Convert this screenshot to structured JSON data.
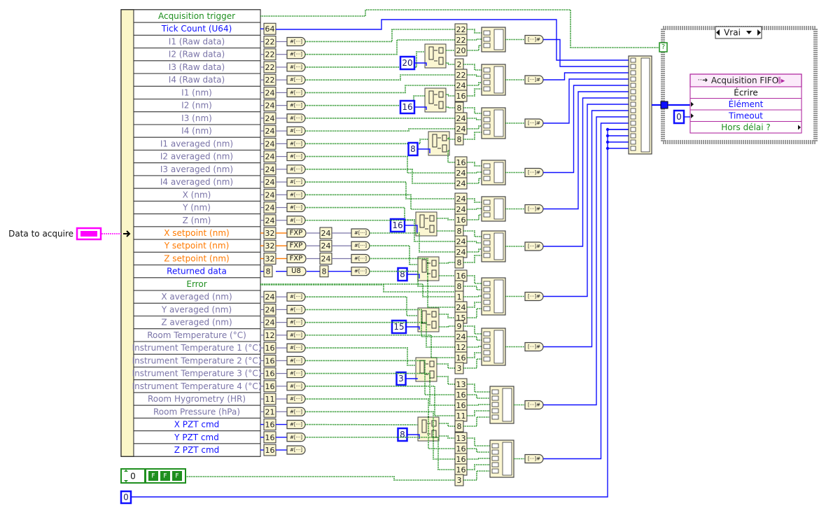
{
  "left_label": "Data to acquire",
  "unbundle": {
    "rows": [
      {
        "label": "Acquisition trigger",
        "type": "bool"
      },
      {
        "label": "Tick Count (U64)",
        "type": "int",
        "width": "64"
      },
      {
        "label": "I1 (Raw data)",
        "type": "fxp",
        "width": "22"
      },
      {
        "label": "I2 (Raw data)",
        "type": "fxp",
        "width": "22"
      },
      {
        "label": "I3 (Raw data)",
        "type": "fxp",
        "width": "22"
      },
      {
        "label": "I4 (Raw data)",
        "type": "fxp",
        "width": "22"
      },
      {
        "label": "I1 (nm)",
        "type": "fxp",
        "width": "24"
      },
      {
        "label": "I2 (nm)",
        "type": "fxp",
        "width": "24"
      },
      {
        "label": "I3 (nm)",
        "type": "fxp",
        "width": "24"
      },
      {
        "label": "I4 (nm)",
        "type": "fxp",
        "width": "24"
      },
      {
        "label": "I1 averaged (nm)",
        "type": "fxp",
        "width": "24"
      },
      {
        "label": "I2 averaged (nm)",
        "type": "fxp",
        "width": "24"
      },
      {
        "label": "I3 averaged (nm)",
        "type": "fxp",
        "width": "24"
      },
      {
        "label": "I4 averaged (nm)",
        "type": "fxp",
        "width": "24"
      },
      {
        "label": "X (nm)",
        "type": "fxp",
        "width": "24"
      },
      {
        "label": "Y (nm)",
        "type": "fxp",
        "width": "24"
      },
      {
        "label": "Z (nm)",
        "type": "fxp",
        "width": "24"
      },
      {
        "label": "X setpoint (nm)",
        "type": "dbl",
        "width": "32",
        "conv": "FXP",
        "conv_width": "24"
      },
      {
        "label": "Y setpoint (nm)",
        "type": "dbl",
        "width": "32",
        "conv": "FXP",
        "conv_width": "24"
      },
      {
        "label": "Z setpoint (nm)",
        "type": "dbl",
        "width": "32",
        "conv": "FXP",
        "conv_width": "24"
      },
      {
        "label": "Returned data",
        "type": "int",
        "width": "8",
        "conv": "U8",
        "conv_width": "8"
      },
      {
        "label": "Error",
        "type": "bool"
      },
      {
        "label": "X averaged (nm)",
        "type": "fxp",
        "width": "24"
      },
      {
        "label": "Y averaged (nm)",
        "type": "fxp",
        "width": "24"
      },
      {
        "label": "Z averaged  (nm)",
        "type": "fxp",
        "width": "24"
      },
      {
        "label": "Room Temperature (°C)",
        "type": "fxp",
        "width": "12"
      },
      {
        "label": "Instrument Temperature 1 (°C)",
        "type": "fxp",
        "width": "16"
      },
      {
        "label": "Instrument Temperature 2 (°C)",
        "type": "fxp",
        "width": "16"
      },
      {
        "label": "Instrument Temperature 3 (°C)",
        "type": "fxp",
        "width": "16"
      },
      {
        "label": "Instrument Temperature 4 (°C)",
        "type": "fxp",
        "width": "16"
      },
      {
        "label": "Room Hygrometry (HR)",
        "type": "fxp",
        "width": "11"
      },
      {
        "label": "Room Pressure (hPa)",
        "type": "fxp",
        "width": "21"
      },
      {
        "label": "X PZT cmd",
        "type": "int",
        "width": "16"
      },
      {
        "label": "Y PZT cmd",
        "type": "int",
        "width": "16"
      },
      {
        "label": "Z PZT cmd",
        "type": "int",
        "width": "16"
      }
    ]
  },
  "split_constants": [
    "20",
    "16",
    "8",
    "16",
    "8",
    "15",
    "3",
    "8"
  ],
  "groups": [
    [
      "22",
      "22",
      "20"
    ],
    [
      "2",
      "22",
      "24",
      "16"
    ],
    [
      "8",
      "24",
      "24",
      "8"
    ],
    [
      "16",
      "24",
      "24"
    ],
    [
      "24",
      "24",
      "16"
    ],
    [
      "8",
      "24",
      "24",
      "8"
    ],
    [
      "16",
      "8",
      "1",
      "24",
      "15"
    ],
    [
      "9",
      "24",
      "12",
      "16",
      "3"
    ],
    [
      "13",
      "16",
      "16",
      "11",
      "8"
    ],
    [
      "13",
      "16",
      "16",
      "16",
      "3"
    ]
  ],
  "case": {
    "selector": "Vrai",
    "selector_terminal": "?"
  },
  "fifo": {
    "title": "Acquisition FIFO",
    "rows": [
      "Écrire",
      "Élément",
      "Timeout",
      "Hors délai ?"
    ]
  },
  "timeout_constant": "0",
  "bottom": {
    "numeric_value": "0",
    "bool_array": [
      "F",
      "F",
      "F"
    ],
    "constant": "0"
  },
  "colors": {
    "bool": "#1f8f1f",
    "int": "#1010ff",
    "fxp": "#7a74a8",
    "dbl": "#ff7a00",
    "node_fill": "#fbf6d2",
    "fifo": "#b02aa0",
    "cluster": "#ff00ff"
  }
}
